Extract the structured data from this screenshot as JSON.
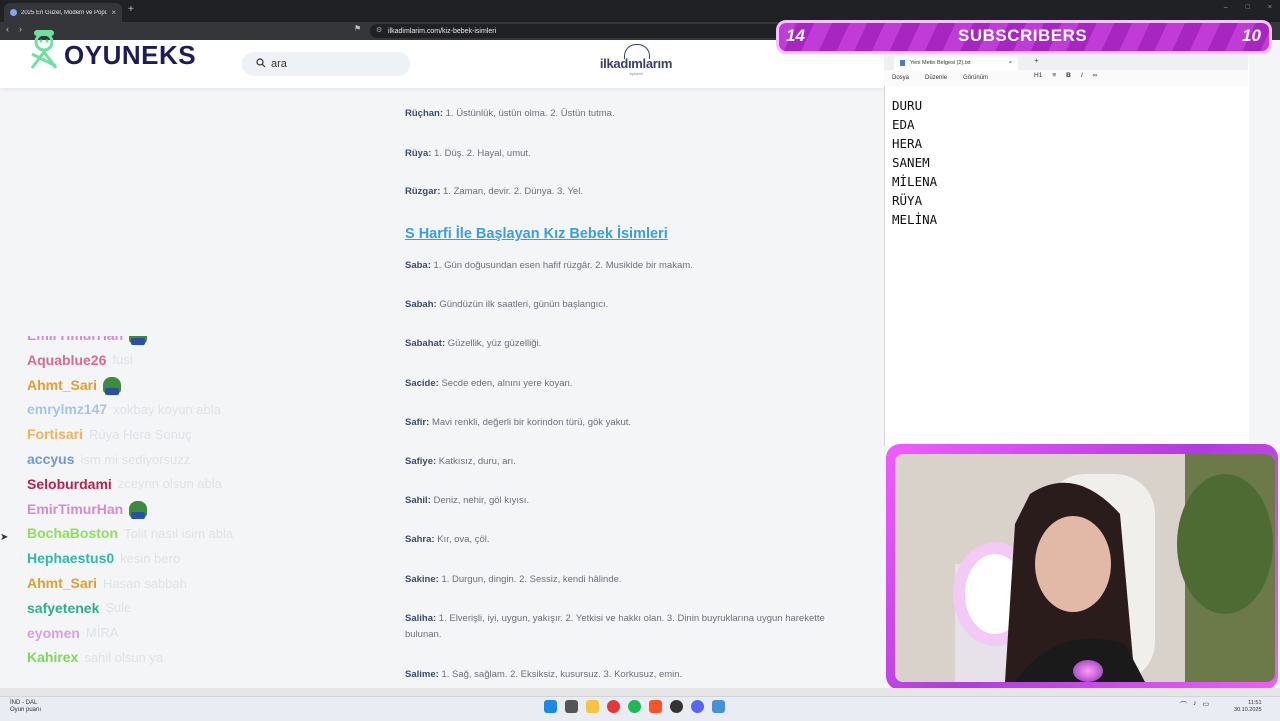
{
  "browser": {
    "tab_title": "2025 En Güzel, Modern ve Popü",
    "tab_close": "×",
    "new_tab": "+",
    "url": "ilkadimlarim.com/kiz-bebek-isimleri",
    "window_controls": [
      "–",
      "□",
      "×"
    ]
  },
  "site": {
    "logo_text": "OYUNEKS",
    "search_placeholder": "ara",
    "brand_name": "ilkadımlarım",
    "brand_sub": "Aptamil"
  },
  "article": {
    "entries_top": [
      {
        "name": "Rüçhan:",
        "meaning": "1. Üstünlük, üstün olma. 2. Üstün tutma."
      },
      {
        "name": "Rüya:",
        "meaning": "1. Düş. 2. Hayal, umut."
      },
      {
        "name": "Rüzgar:",
        "meaning": "1. Zaman, devir. 2. Dünya. 3. Yel."
      }
    ],
    "section_heading": "S Harfi İle Başlayan Kız Bebek İsimleri",
    "entries": [
      {
        "name": "Saba:",
        "meaning": "1. Gün doğusundan esen hafif rüzgâr. 2. Musikide bir makam."
      },
      {
        "name": "Sabah:",
        "meaning": "Gündüzün ilk saatleri, günün başlangıcı."
      },
      {
        "name": "Sabahat:",
        "meaning": "Güzellik, yüz güzelliği."
      },
      {
        "name": "Sacide:",
        "meaning": "Secde eden, alnını yere koyan."
      },
      {
        "name": "Safir:",
        "meaning": "Mavi renkli, değerli bir korindon türü, gök yakut."
      },
      {
        "name": "Safiye:",
        "meaning": "Katkısız, duru, arı."
      },
      {
        "name": "Sahil:",
        "meaning": "Deniz, nehir, göl kıyısı."
      },
      {
        "name": "Sahra:",
        "meaning": "Kır, ova, çöl."
      },
      {
        "name": "Sakine:",
        "meaning": "1. Durgun, dingin. 2. Sessiz, kendi hâlinde."
      },
      {
        "name": "Saliha:",
        "meaning": "1. Elverişli, iyi, uygun, yakışır. 2. Yetkisi ve hakkı olan. 3. Dinin buyruklarına uygun harekette bulunan."
      },
      {
        "name": "Salime:",
        "meaning": "1. Sağ, sağlam. 2. Eksiksiz, kusursuz. 3. Korkusuz, emin."
      }
    ]
  },
  "chat": [
    {
      "user": "EmirTimurHan",
      "msg": "",
      "color": "#d988d8",
      "emote": true
    },
    {
      "user": "Aquablue26",
      "msg": "fusi",
      "color": "#d86a8f",
      "emote": false
    },
    {
      "user": "Ahmt_Sari",
      "msg": "",
      "color": "#e0a030",
      "emote": true
    },
    {
      "user": "emrylmz147",
      "msg": "xokbay koyun abla",
      "color": "#a9c4e8",
      "emote": false
    },
    {
      "user": "Fortisari",
      "msg": "Rüya Hera Sonuç",
      "color": "#efb35a",
      "emote": false
    },
    {
      "user": "accyus",
      "msg": "ism mi sediyorsuzz",
      "color": "#6b9ad8",
      "emote": false
    },
    {
      "user": "Seloburdami",
      "msg": "zceynn olsun abla",
      "color": "#b4254e",
      "emote": false
    },
    {
      "user": "EmirTimurHan",
      "msg": "",
      "color": "#d988d8",
      "emote": true
    },
    {
      "user": "BochaBoston",
      "msg": "Tolit nasıl isim abla",
      "color": "#8ee05a",
      "emote": false
    },
    {
      "user": "Hephaestus0",
      "msg": "kesin bero",
      "color": "#2fb9a8",
      "emote": false
    },
    {
      "user": "Ahmt_Sari",
      "msg": "Hasan sabbah",
      "color": "#e0a030",
      "emote": false
    },
    {
      "user": "safyetenek",
      "msg": "Şule",
      "color": "#2eaf8f",
      "emote": false
    },
    {
      "user": "eyomen",
      "msg": "MİRA",
      "color": "#d9a0e0",
      "emote": false
    },
    {
      "user": "Kahirex",
      "msg": "sahil olsun ya",
      "color": "#7ed957",
      "emote": false
    }
  ],
  "overlay": {
    "left_count": "14",
    "title": "SUBSCRIBERS",
    "right_count": "10"
  },
  "notepad": {
    "tab_title": "Yeni Metin Belgesi (2).txt",
    "tab_close": "×",
    "new_tab": "+",
    "menu": [
      "Dosya",
      "Düzenle",
      "Görünüm"
    ],
    "heading_level": "H1",
    "tools": [
      "B",
      "I"
    ],
    "lines": [
      "DURU",
      "EDA",
      "HERA",
      "SANEM",
      "MİLENA",
      "RÜYA",
      "MELİNA"
    ]
  },
  "taskbar": {
    "weather_title": "İND - DAL",
    "weather_sub": "Oyun puanı",
    "time": "11:51",
    "date": "30.10.2025"
  },
  "colors": {
    "overlay_purple": "#c13bd8",
    "section_link": "#3aa0d8",
    "logo_navy": "#1f1a5a"
  }
}
